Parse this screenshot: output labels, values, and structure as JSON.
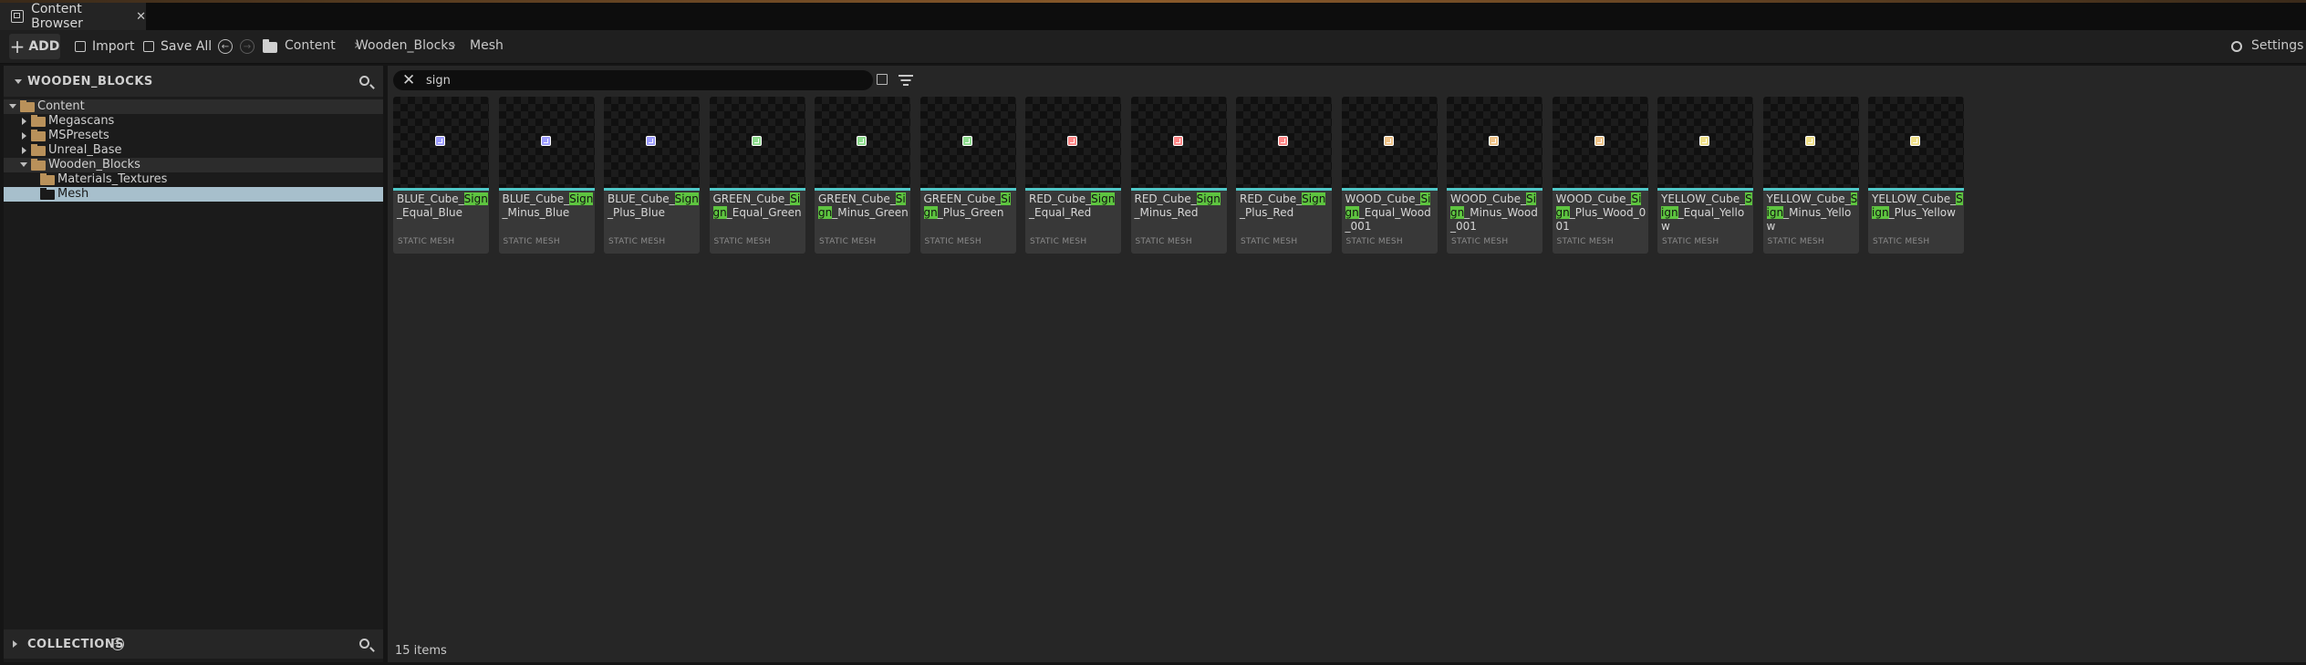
{
  "window": {
    "tab_title": "Content Browser"
  },
  "toolbar": {
    "add_label": "ADD",
    "import_label": "Import",
    "save_all_label": "Save All",
    "breadcrumb": [
      "Content",
      "Wooden_Blocks",
      "Mesh"
    ],
    "settings_label": "Settings"
  },
  "sources": {
    "title": "WOODEN_BLOCKS",
    "tree": [
      {
        "label": "Content",
        "depth": 0,
        "expanded": true
      },
      {
        "label": "Megascans",
        "depth": 1,
        "expanded": false
      },
      {
        "label": "MSPresets",
        "depth": 1,
        "expanded": false
      },
      {
        "label": "Unreal_Base",
        "depth": 1,
        "expanded": false
      },
      {
        "label": "Wooden_Blocks",
        "depth": 1,
        "expanded": true
      },
      {
        "label": "Materials_Textures",
        "depth": 2
      },
      {
        "label": "Mesh",
        "depth": 2,
        "selected": true
      }
    ],
    "collections_label": "COLLECTIONS"
  },
  "search": {
    "value": "sign",
    "highlight": "Sign"
  },
  "assets": [
    {
      "name": "BLUE_Cube_Sign_Equal_Blue",
      "type": "STATIC MESH",
      "color": "#9f9fff"
    },
    {
      "name": "BLUE_Cube_Sign_Minus_Blue",
      "type": "STATIC MESH",
      "color": "#9f9fff"
    },
    {
      "name": "BLUE_Cube_Sign_Plus_Blue",
      "type": "STATIC MESH",
      "color": "#9f9fff"
    },
    {
      "name": "GREEN_Cube_Sign_Equal_Green",
      "type": "STATIC MESH",
      "color": "#8fdc8f"
    },
    {
      "name": "GREEN_Cube_Sign_Minus_Green",
      "type": "STATIC MESH",
      "color": "#8fdc8f"
    },
    {
      "name": "GREEN_Cube_Sign_Plus_Green",
      "type": "STATIC MESH",
      "color": "#8fdc8f"
    },
    {
      "name": "RED_Cube_Sign_Equal_Red",
      "type": "STATIC MESH",
      "color": "#ff8888"
    },
    {
      "name": "RED_Cube_Sign_Minus_Red",
      "type": "STATIC MESH",
      "color": "#ff8888"
    },
    {
      "name": "RED_Cube_Sign_Plus_Red",
      "type": "STATIC MESH",
      "color": "#ff8888"
    },
    {
      "name": "WOOD_Cube_Sign_Equal_Wood_001",
      "type": "STATIC MESH",
      "color": "#f0c48a"
    },
    {
      "name": "WOOD_Cube_Sign_Minus_Wood_001",
      "type": "STATIC MESH",
      "color": "#f0c48a"
    },
    {
      "name": "WOOD_Cube_Sign_Plus_Wood_001",
      "type": "STATIC MESH",
      "color": "#f0c48a"
    },
    {
      "name": "YELLOW_Cube_Sign_Equal_Yellow",
      "type": "STATIC MESH",
      "color": "#f0e08a"
    },
    {
      "name": "YELLOW_Cube_Sign_Minus_Yellow",
      "type": "STATIC MESH",
      "color": "#f0e08a"
    },
    {
      "name": "YELLOW_Cube_Sign_Plus_Yellow",
      "type": "STATIC MESH",
      "color": "#f0e08a"
    }
  ],
  "status": {
    "item_count": "15 items"
  },
  "colors": {
    "accent": "#4fc7c7",
    "search_highlight": "#5ec440",
    "selection": "#a7bfcc",
    "folder": "#b9915a"
  }
}
